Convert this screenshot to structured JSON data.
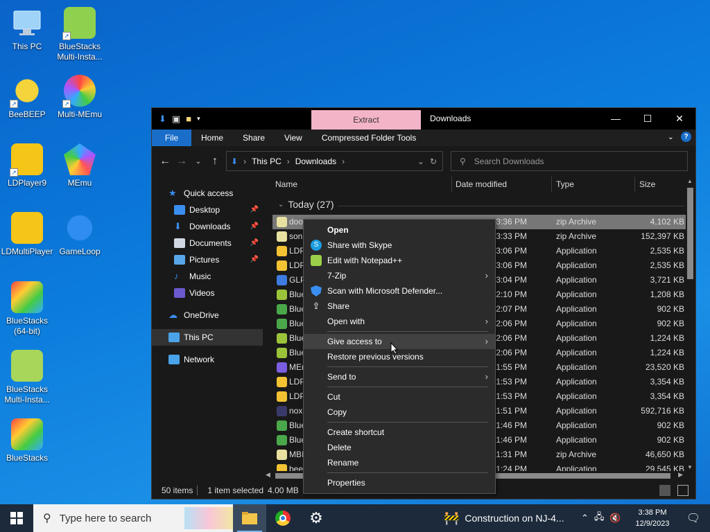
{
  "desktop": {
    "icons": [
      {
        "label": "This PC",
        "icon": "monitor-icon"
      },
      {
        "label": "BlueStacks Multi-Insta...",
        "icon": "bluestacks-multi-icon"
      },
      {
        "label": "BeeBEEP",
        "icon": "bee-icon"
      },
      {
        "label": "Multi-MEmu",
        "icon": "memu-multi-icon"
      },
      {
        "label": "LDPlayer9",
        "icon": "ldplayer-icon"
      },
      {
        "label": "MEmu",
        "icon": "memu-icon"
      },
      {
        "label": "LDMultiPlayer",
        "icon": "ldmultiplayer-icon"
      },
      {
        "label": "GameLoop",
        "icon": "gameloop-icon"
      },
      {
        "label": "BlueStacks (64-bit)",
        "icon": "bluestacks64-icon"
      },
      {
        "label": "BlueStacks Multi-Insta...",
        "icon": "bluestacks-multi-icon"
      },
      {
        "label": "BlueStacks",
        "icon": "bluestacks-icon"
      }
    ]
  },
  "window": {
    "extract_tab": "Extract",
    "title": "Downloads",
    "ribbon": {
      "file": "File",
      "home": "Home",
      "share": "Share",
      "view": "View",
      "tools": "Compressed Folder Tools"
    },
    "address": {
      "root": "This PC",
      "folder": "Downloads"
    },
    "search_placeholder": "Search Downloads",
    "nav": {
      "quick_access": "Quick access",
      "desktop": "Desktop",
      "downloads": "Downloads",
      "documents": "Documents",
      "pictures": "Pictures",
      "music": "Music",
      "videos": "Videos",
      "onedrive": "OneDrive",
      "this_pc": "This PC",
      "network": "Network"
    },
    "columns": {
      "name": "Name",
      "date": "Date modified",
      "type": "Type",
      "size": "Size"
    },
    "group": "Today (27)",
    "rows": [
      {
        "name": "doo",
        "date": "3:36 PM",
        "type": "zip Archive",
        "size": "4,102 KB",
        "color": "#e8e0a0"
      },
      {
        "name": "son",
        "date": "3:33 PM",
        "type": "zip Archive",
        "size": "152,397 KB",
        "color": "#e8e0a0"
      },
      {
        "name": "LDP",
        "date": "3:06 PM",
        "type": "Application",
        "size": "2,535 KB",
        "color": "#f2c233"
      },
      {
        "name": "LDP",
        "date": "3:06 PM",
        "type": "Application",
        "size": "2,535 KB",
        "color": "#f2c233"
      },
      {
        "name": "GLP",
        "date": "3:04 PM",
        "type": "Application",
        "size": "3,721 KB",
        "color": "#3d7be0"
      },
      {
        "name": "Blue",
        "date": "2:10 PM",
        "type": "Application",
        "size": "1,208 KB",
        "color": "#9bc33a"
      },
      {
        "name": "Blue",
        "date": "2:07 PM",
        "type": "Application",
        "size": "902 KB",
        "color": "#4aa84a"
      },
      {
        "name": "Blue",
        "date": "2:06 PM",
        "type": "Application",
        "size": "902 KB",
        "color": "#4aa84a"
      },
      {
        "name": "Blue",
        "date": "2:06 PM",
        "type": "Application",
        "size": "1,224 KB",
        "color": "#9bc33a"
      },
      {
        "name": "Blue",
        "date": "2:06 PM",
        "type": "Application",
        "size": "1,224 KB",
        "color": "#9bc33a"
      },
      {
        "name": "MEr",
        "date": "1:55 PM",
        "type": "Application",
        "size": "23,520 KB",
        "color": "#7a5de0"
      },
      {
        "name": "LDP",
        "date": "1:53 PM",
        "type": "Application",
        "size": "3,354 KB",
        "color": "#f2c233"
      },
      {
        "name": "LDP",
        "date": "1:53 PM",
        "type": "Application",
        "size": "3,354 KB",
        "color": "#f2c233"
      },
      {
        "name": "nox",
        "date": "1:51 PM",
        "type": "Application",
        "size": "592,716 KB",
        "color": "#3a3a6a"
      },
      {
        "name": "Blue",
        "date": "1:46 PM",
        "type": "Application",
        "size": "902 KB",
        "color": "#4aa84a"
      },
      {
        "name": "Blue",
        "date": "1:46 PM",
        "type": "Application",
        "size": "902 KB",
        "color": "#4aa84a"
      },
      {
        "name": "MBI",
        "date": "1:31 PM",
        "type": "zip Archive",
        "size": "46,650 KB",
        "color": "#e8e0a0"
      },
      {
        "name": "bee",
        "date": "1:24 PM",
        "type": "Application",
        "size": "29,545 KB",
        "color": "#f2c233"
      }
    ],
    "status": {
      "count": "50 items",
      "selected": "1 item selected",
      "size": "4.00 MB"
    }
  },
  "context_menu": {
    "items": {
      "open": "Open",
      "skype": "Share with Skype",
      "notepad": "Edit with Notepad++",
      "sevenzip": "7-Zip",
      "defender": "Scan with Microsoft Defender...",
      "share": "Share",
      "open_with": "Open with",
      "give_access": "Give access to",
      "restore": "Restore previous versions",
      "send_to": "Send to",
      "cut": "Cut",
      "copy": "Copy",
      "create_shortcut": "Create shortcut",
      "delete": "Delete",
      "rename": "Rename",
      "properties": "Properties"
    }
  },
  "taskbar": {
    "search_placeholder": "Type here to search",
    "news": "Construction on NJ-4...",
    "time": "3:38 PM",
    "date": "12/9/2023"
  }
}
